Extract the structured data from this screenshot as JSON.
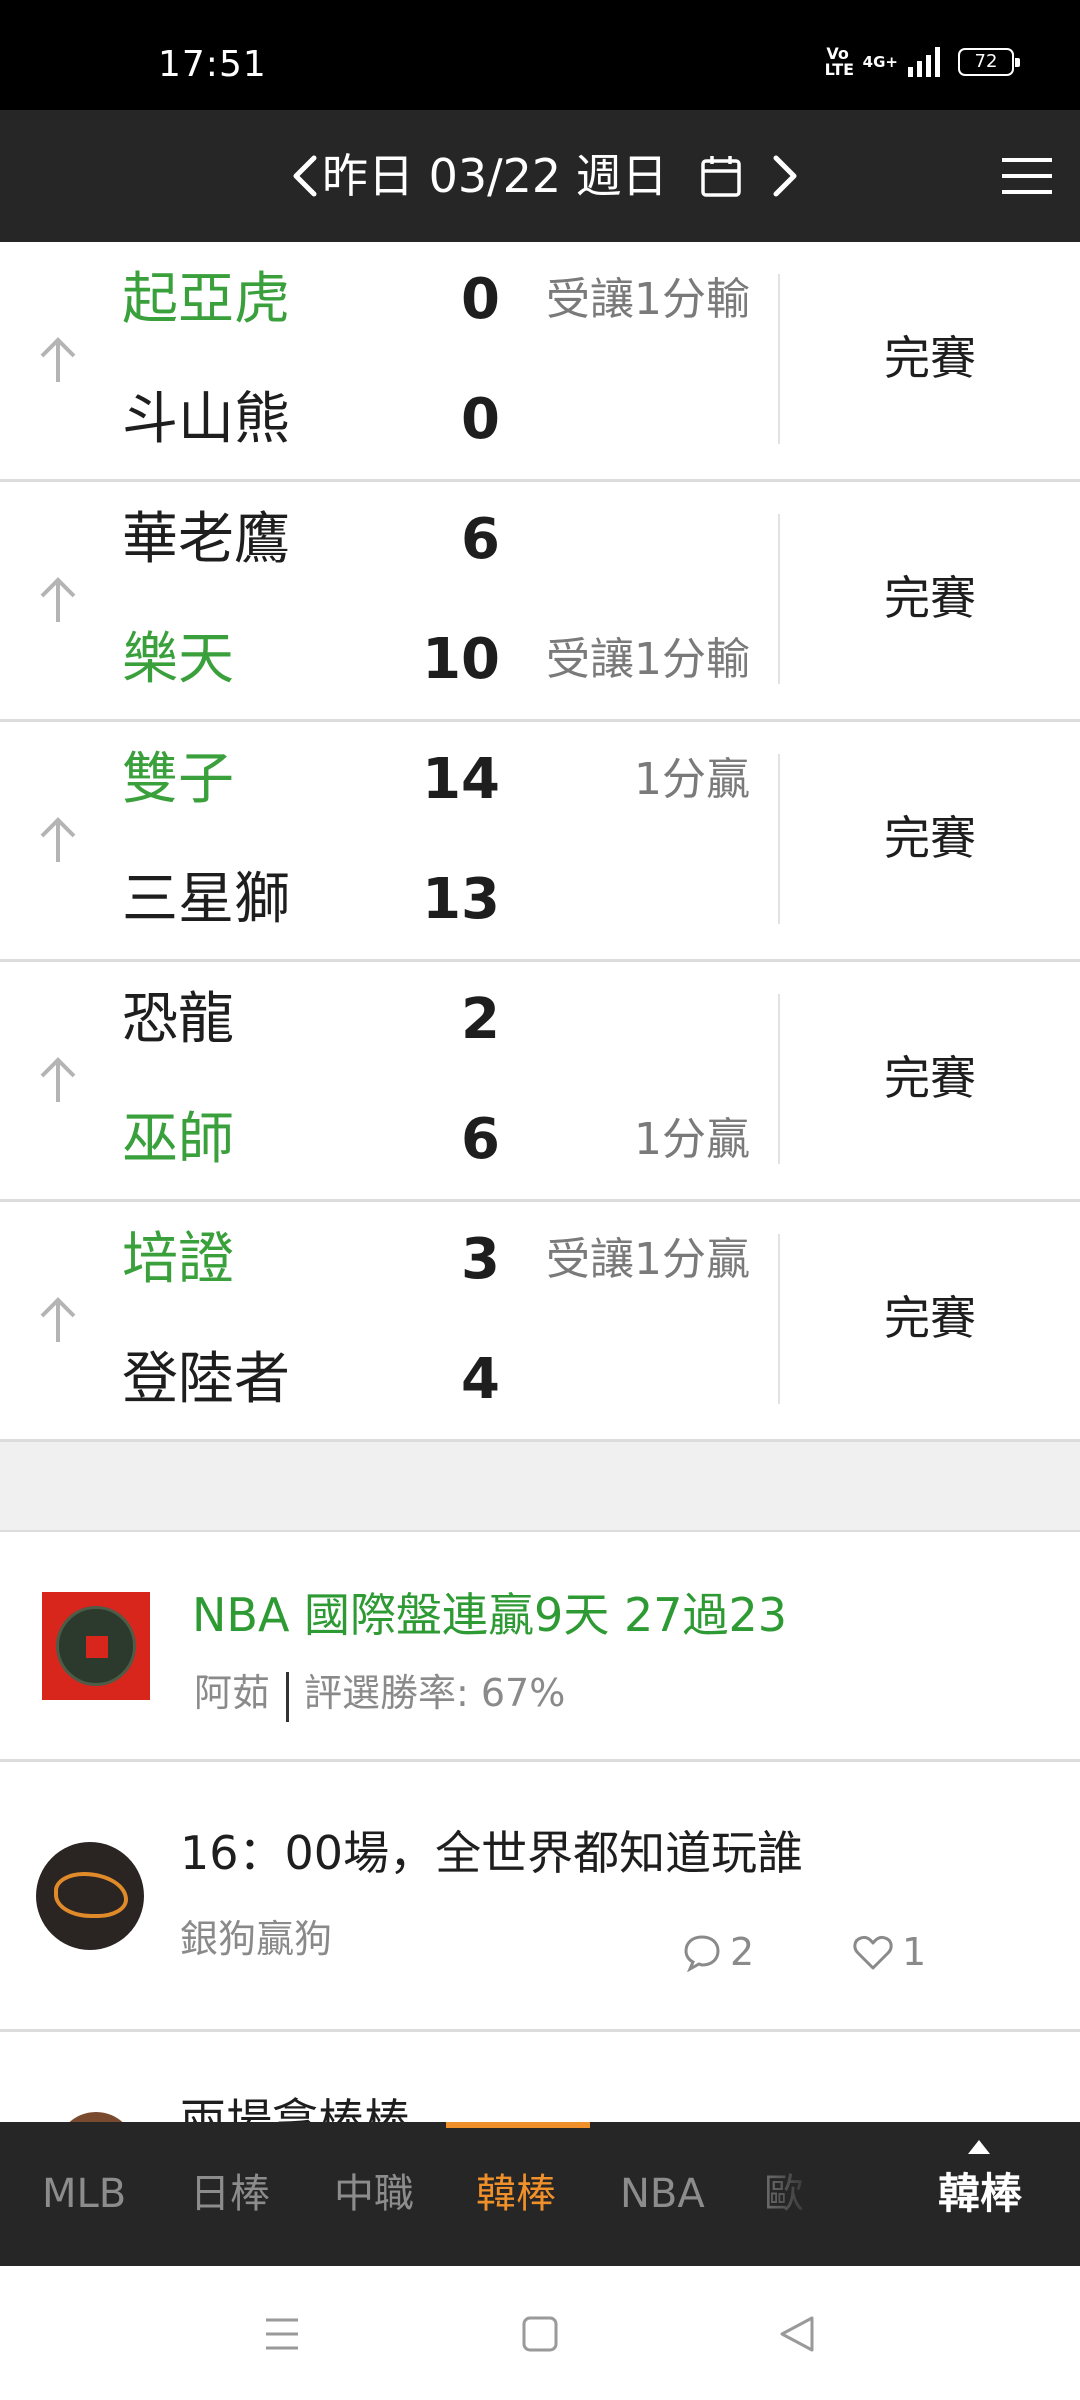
{
  "status_bar": {
    "time": "17:51",
    "volte": "Vo\nLTE",
    "network": "4G+",
    "battery": "72"
  },
  "header": {
    "date_label": "昨日 03/22 週日"
  },
  "games": [
    {
      "top": {
        "team": "起亞虎",
        "score": "0",
        "handicap": "受讓1分輸",
        "winner": true
      },
      "bottom": {
        "team": "斗山熊",
        "score": "0",
        "handicap": "",
        "winner": false
      },
      "status": "完賽"
    },
    {
      "top": {
        "team": "華老鷹",
        "score": "6",
        "handicap": "",
        "winner": false
      },
      "bottom": {
        "team": "樂天",
        "score": "10",
        "handicap": "受讓1分輸",
        "winner": true
      },
      "status": "完賽"
    },
    {
      "top": {
        "team": "雙子",
        "score": "14",
        "handicap": "1分贏",
        "winner": true
      },
      "bottom": {
        "team": "三星獅",
        "score": "13",
        "handicap": "",
        "winner": false
      },
      "status": "完賽"
    },
    {
      "top": {
        "team": "恐龍",
        "score": "2",
        "handicap": "",
        "winner": false
      },
      "bottom": {
        "team": "巫師",
        "score": "6",
        "handicap": "1分贏",
        "winner": true
      },
      "status": "完賽"
    },
    {
      "top": {
        "team": "培證",
        "score": "3",
        "handicap": "受讓1分贏",
        "winner": true
      },
      "bottom": {
        "team": "登陸者",
        "score": "4",
        "handicap": "",
        "winner": false
      },
      "status": "完賽"
    }
  ],
  "posts": [
    {
      "title": "NBA 國際盤連贏9天 27過23",
      "author": "阿茹",
      "rate": "評選勝率: 67%",
      "thumb_icon": "coin-thumbnail"
    },
    {
      "title": "16：00場，全世界都知道玩誰",
      "author": "銀狗贏狗",
      "comments": "2",
      "likes": "1",
      "avatar_icon": "wolf-avatar"
    },
    {
      "title": "兩場拿棒棒"
    }
  ],
  "tabs": {
    "items": [
      "MLB",
      "日棒",
      "中職",
      "韓棒",
      "NBA",
      "歐"
    ],
    "active": "韓棒",
    "current": "韓棒"
  },
  "colors": {
    "win_green": "#3aa03c",
    "accent_orange": "#f0902a",
    "header_bg": "#262626"
  }
}
